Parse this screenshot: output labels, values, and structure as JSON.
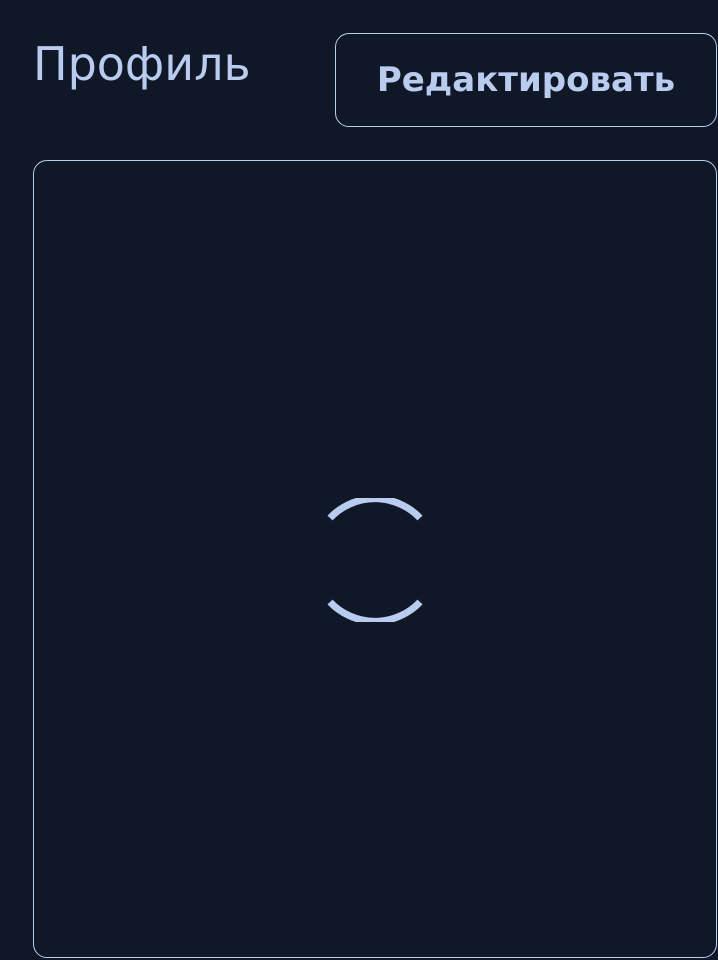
{
  "header": {
    "title": "Профиль",
    "edit_label": "Редактировать"
  },
  "profile_card": {
    "state": "loading",
    "spinner_icon": "loading-spinner-icon"
  },
  "colors": {
    "background": "#101828",
    "accent": "#b9ccef"
  }
}
